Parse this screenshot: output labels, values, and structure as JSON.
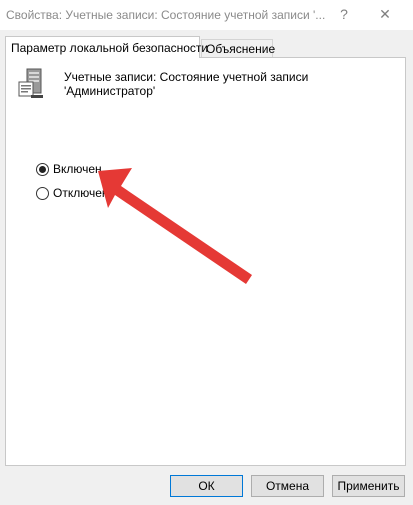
{
  "window": {
    "title": "Свойства: Учетные записи: Состояние учетной записи '...",
    "help_label": "?",
    "close_label": "✕"
  },
  "tabs": [
    {
      "label": "Параметр локальной безопасности",
      "active": true
    },
    {
      "label": "Объяснение",
      "active": false
    }
  ],
  "policy": {
    "icon": "server-policy-icon",
    "name": "Учетные записи: Состояние учетной записи 'Администратор'"
  },
  "options": [
    {
      "label": "Включен",
      "checked": true
    },
    {
      "label": "Отключен",
      "checked": false
    }
  ],
  "annotation": {
    "color": "#e53935"
  },
  "buttons": {
    "ok": "ОК",
    "cancel": "Отмена",
    "apply": "Применить"
  }
}
